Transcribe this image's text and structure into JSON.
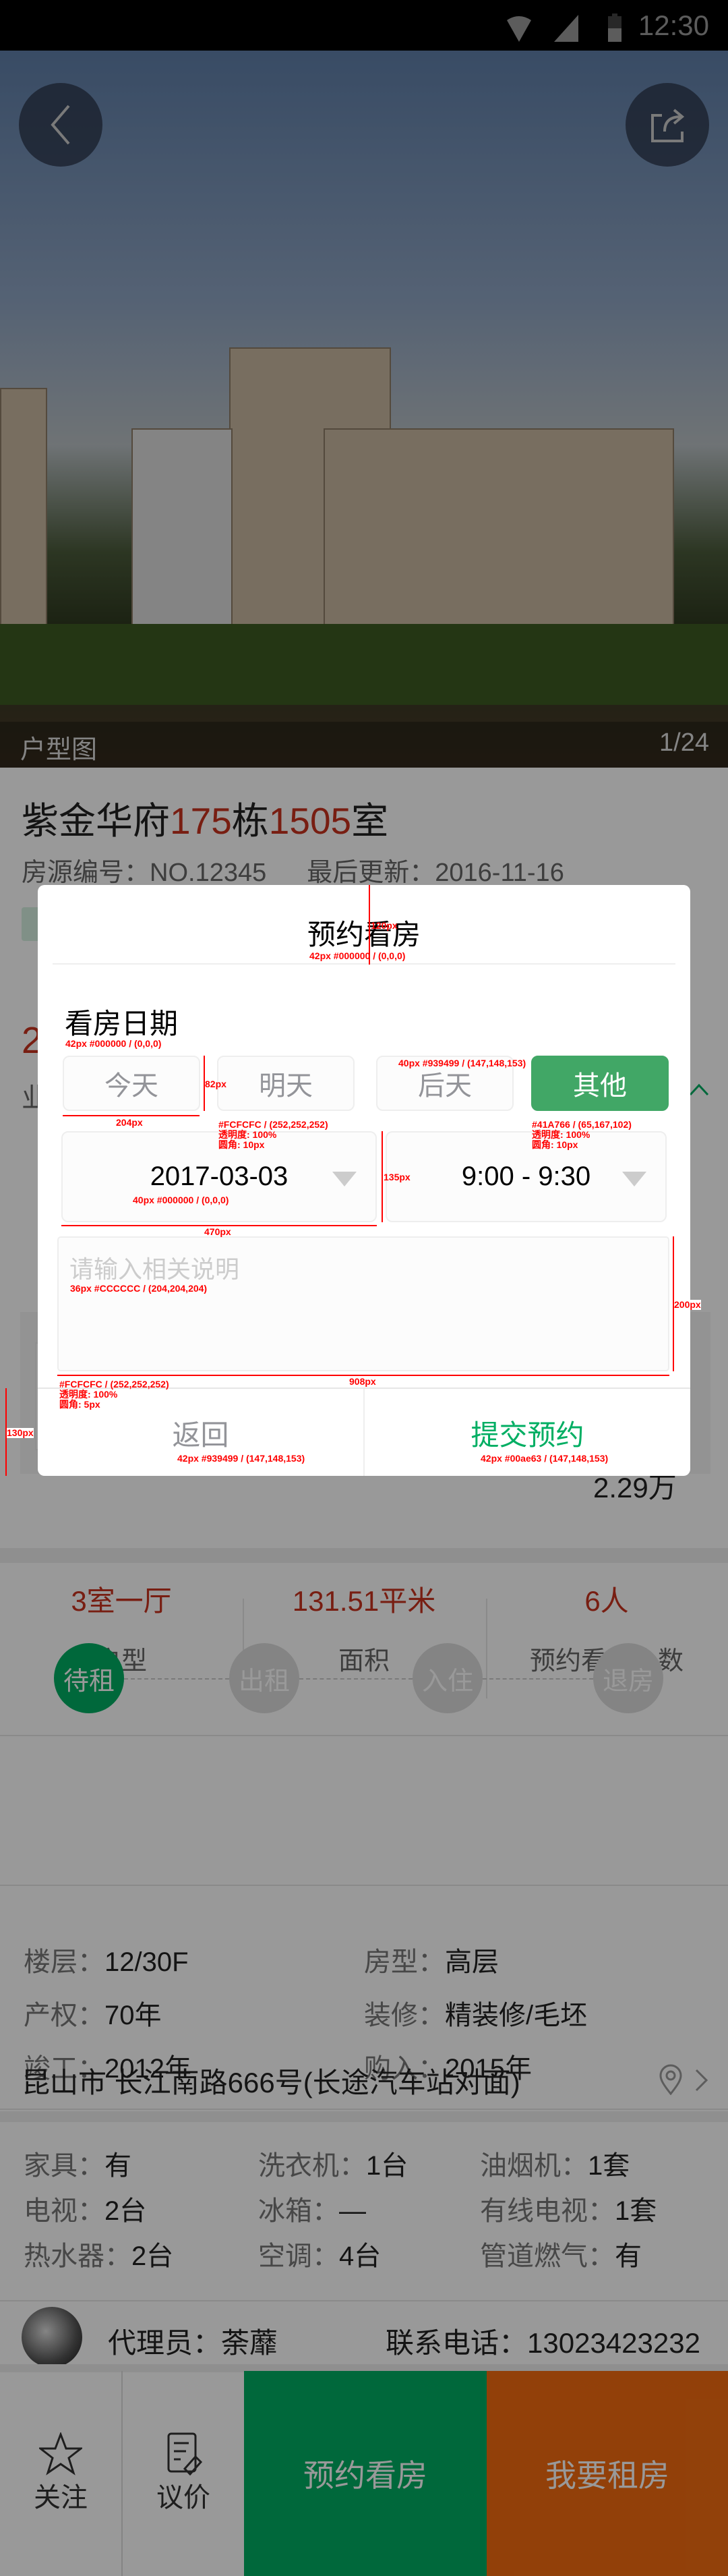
{
  "status_bar": {
    "time": "12:30"
  },
  "hero": {
    "caption": "户型图",
    "counter": "1/24"
  },
  "listing": {
    "name": "紫金华府",
    "building_no": "175",
    "building_unit": "栋",
    "room_no": "1505",
    "room_unit": "室",
    "id_label": "房源编号：",
    "id_value": "NO.12345",
    "updated_label": "最后更新：",
    "updated_value": "2016-11-16",
    "hidden_fragment_1": "2",
    "hidden_fragment_2": "业",
    "price": "2.29万"
  },
  "stats": [
    {
      "value": "3室一厅",
      "label": "户型"
    },
    {
      "value": "131.51平米",
      "label": "面积"
    },
    {
      "value": "6人",
      "label": "预约看房人数"
    }
  ],
  "steps": [
    {
      "label": "待租",
      "active": true
    },
    {
      "label": "出租",
      "active": false
    },
    {
      "label": "入住",
      "active": false
    },
    {
      "label": "退房",
      "active": false
    }
  ],
  "info": [
    {
      "k": "楼层：",
      "v": "12/30F"
    },
    {
      "k": "房型：",
      "v": "高层"
    },
    {
      "k": "产权：",
      "v": "70年"
    },
    {
      "k": "装修：",
      "v": "精装修/毛坯"
    },
    {
      "k": "竣工：",
      "v": "2012年"
    },
    {
      "k": "购入：",
      "v": "2015年"
    }
  ],
  "address": "昆山市 长江南路666号(长途汽车站对面)",
  "appliances": [
    {
      "k": "家具：",
      "v": "有"
    },
    {
      "k": "洗衣机：",
      "v": "1台"
    },
    {
      "k": "油烟机：",
      "v": "1套"
    },
    {
      "k": "电视：",
      "v": "2台"
    },
    {
      "k": "冰箱：",
      "v": "—"
    },
    {
      "k": "有线电视：",
      "v": "1套"
    },
    {
      "k": "热水器：",
      "v": "2台"
    },
    {
      "k": "空调：",
      "v": "4台"
    },
    {
      "k": "管道燃气：",
      "v": "有"
    }
  ],
  "agent": {
    "label": "代理员：",
    "name": "荼蘼",
    "phone_label": "联系电话：",
    "phone": "13023423232"
  },
  "bottom_nav": {
    "follow": "关注",
    "bargain": "议价",
    "book": "预约看房",
    "rent": "我要租房"
  },
  "modal": {
    "title": "预约看房",
    "date_label": "看房日期",
    "options": [
      "今天",
      "明天",
      "后天",
      "其他"
    ],
    "selected_option": "其他",
    "date": "2017-03-03",
    "time": "9:00 - 9:30",
    "note_placeholder": "请输入相关说明",
    "back": "返回",
    "submit": "提交预约"
  },
  "annotations": {
    "a1": "120px",
    "a2": "42px #000000 / (0,0,0)",
    "a3": "42px #000000 / (0,0,0)",
    "a4": "82px",
    "a5": "204px",
    "a6": "#FCFCFC / (252,252,252)",
    "a7": "透明度: 100%",
    "a8": "圆角: 10px",
    "a9": "40px #939499 / (147,148,153)",
    "a10": "#41A766 / (65,167,102)",
    "a11": "透明度: 100%",
    "a12": "圆角: 10px",
    "a13": "135px",
    "a14": "40px #000000 / (0,0,0)",
    "a15": "470px",
    "a16": "36px #CCCCCC / (204,204,204)",
    "a17": "200px",
    "a18": "908px",
    "a19": "#FCFCFC / (252,252,252)",
    "a20": "透明度: 100%",
    "a21": "圆角: 5px",
    "a22": "130px",
    "a23": "42px #939499 / (147,148,153)",
    "a24": "42px #00ae63 / (147,148,153)"
  },
  "colors": {
    "green": "#00ae63",
    "option_green": "#41A766",
    "red": "#c8321e",
    "orange": "#f36c10"
  }
}
